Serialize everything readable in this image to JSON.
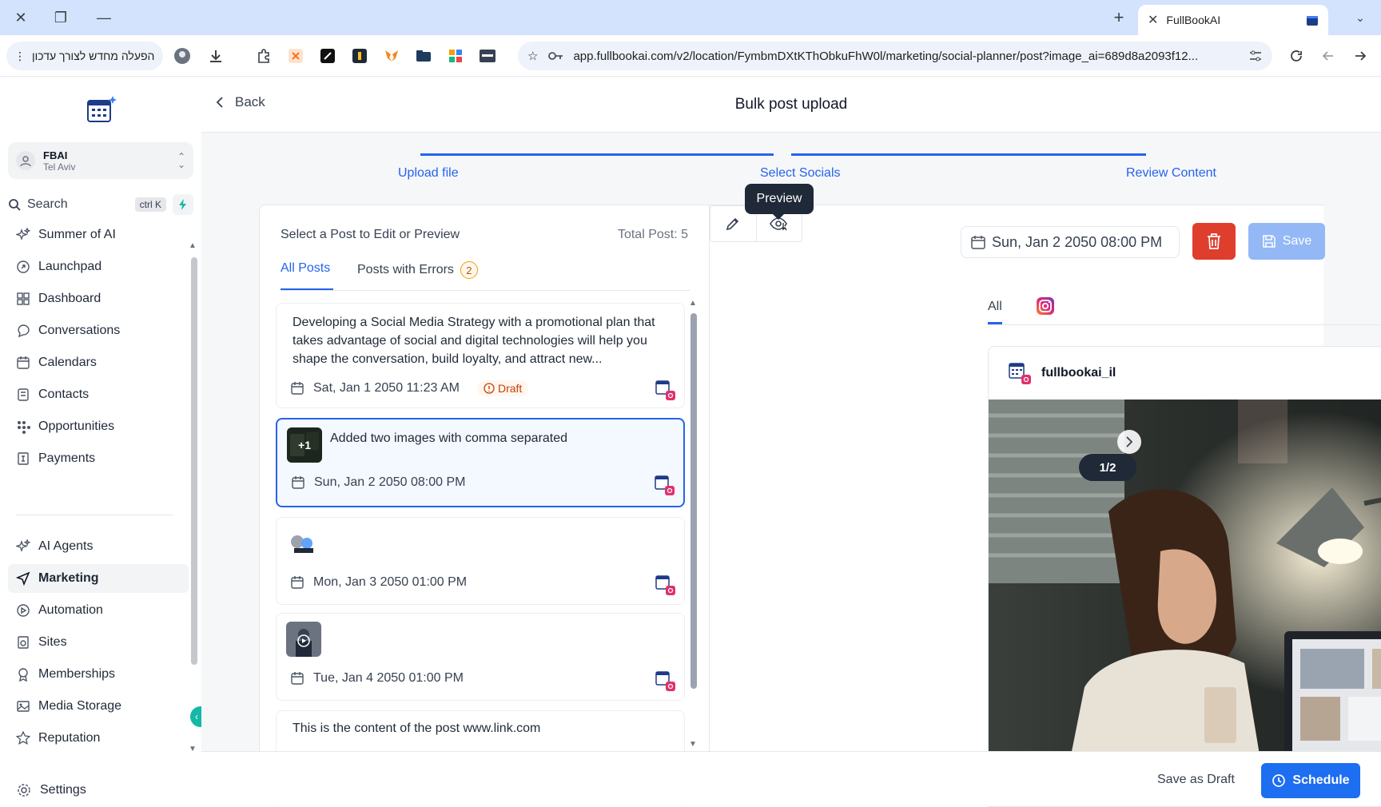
{
  "browser": {
    "tab_title": "FullBookAI",
    "update_button": "הפעלה מחדש לצורך עדכון",
    "url": "app.fullbookai.com/v2/location/FymbmDXtKThObkuFhW0l/marketing/social-planner/post?image_ai=689d8a2093f12..."
  },
  "sidebar": {
    "location_name": "FBAI",
    "location_sub": "Tel Aviv",
    "search_label": "Search",
    "search_shortcut": "ctrl K",
    "items": [
      {
        "label": "Summer of AI",
        "icon": "sparkles-icon"
      },
      {
        "label": "Launchpad",
        "icon": "rocket-icon"
      },
      {
        "label": "Dashboard",
        "icon": "grid-icon"
      },
      {
        "label": "Conversations",
        "icon": "chat-icon"
      },
      {
        "label": "Calendars",
        "icon": "calendar-icon"
      },
      {
        "label": "Contacts",
        "icon": "contacts-icon"
      },
      {
        "label": "Opportunities",
        "icon": "opportunities-icon"
      },
      {
        "label": "Payments",
        "icon": "payments-icon"
      },
      {
        "label": "AI Agents",
        "icon": "sparkles-icon"
      },
      {
        "label": "Marketing",
        "icon": "send-icon"
      },
      {
        "label": "Automation",
        "icon": "automation-icon"
      },
      {
        "label": "Sites",
        "icon": "sites-icon"
      },
      {
        "label": "Memberships",
        "icon": "memberships-icon"
      },
      {
        "label": "Media Storage",
        "icon": "image-icon"
      },
      {
        "label": "Reputation",
        "icon": "star-icon"
      }
    ],
    "settings_label": "Settings"
  },
  "header": {
    "back_label": "Back",
    "title": "Bulk post upload"
  },
  "steps": [
    "Upload file",
    "Select Socials",
    "Review Content"
  ],
  "tooltip": "Preview",
  "post_list": {
    "heading": "Select a Post to Edit or Preview",
    "total": "Total Post: 5",
    "tab_all": "All Posts",
    "tab_errors": "Posts with Errors",
    "error_count": "2",
    "posts": [
      {
        "text": "Developing a Social Media Strategy with a promotional plan that takes advantage of social and digital technologies will help you shape the conversation, build loyalty, and attract new...",
        "date": "Sat, Jan 1 2050 11:23 AM",
        "status": "Draft"
      },
      {
        "text": "Added two images with comma separated",
        "date": "Sun, Jan 2 2050 08:00 PM",
        "thumb_badge": "+1"
      },
      {
        "text": "",
        "date": "Mon, Jan 3 2050 01:00 PM"
      },
      {
        "text": "",
        "date": "Tue, Jan 4 2050 01:00 PM"
      },
      {
        "text": "This is the content of the post www.link.com",
        "date": ""
      }
    ]
  },
  "preview": {
    "date": "Sun, Jan 2 2050 08:00 PM",
    "save_label": "Save",
    "tab_all": "All",
    "username": "fullbookai_il",
    "counter": "1/2"
  },
  "footer": {
    "save_draft": "Save as Draft",
    "schedule": "Schedule"
  },
  "colors": {
    "accent": "#2563eb",
    "delete": "#e03e2d",
    "schedule": "#1d6ef0"
  }
}
